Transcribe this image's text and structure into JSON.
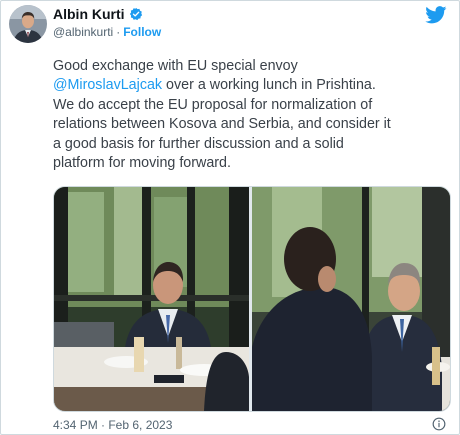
{
  "author": {
    "name": "Albin Kurti",
    "handle": "@albinkurti",
    "separator": "·",
    "follow_label": "Follow",
    "verified": true,
    "avatar_icon": "profile-photo",
    "brand_icon": "twitter-bird-icon"
  },
  "tweet": {
    "line1": "Good exchange with EU special envoy",
    "mention": "@MiroslavLajcak",
    "line2_rest": " over a working lunch in Prishtina.",
    "line3": "We do accept the EU proposal for normalization of",
    "line4": "relations between Kosova and Serbia, and consider it",
    "line5": "a good basis for further discussion and a solid",
    "line6": "platform for moving forward."
  },
  "media": {
    "count": 2,
    "items": [
      "photo-lunch-meeting-left",
      "photo-lunch-meeting-right"
    ]
  },
  "footer": {
    "timestamp": "4:34 PM · Feb 6, 2023",
    "info_icon": "info-icon"
  },
  "colors": {
    "accent": "#1d9bf0",
    "text": "#0f1419",
    "secondary": "#536471",
    "border": "#cfd9de"
  }
}
